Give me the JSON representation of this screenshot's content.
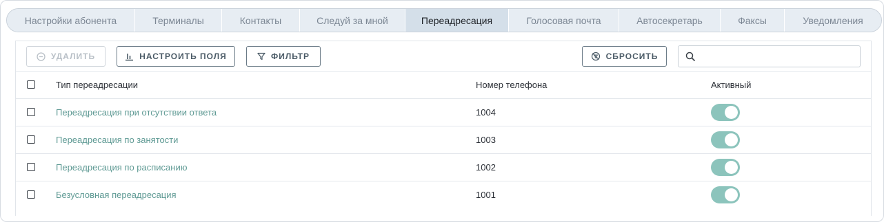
{
  "tabs": [
    {
      "label": "Настройки абонента",
      "active": false
    },
    {
      "label": "Терминалы",
      "active": false
    },
    {
      "label": "Контакты",
      "active": false
    },
    {
      "label": "Следуй за мной",
      "active": false
    },
    {
      "label": "Переадресация",
      "active": true
    },
    {
      "label": "Голосовая почта",
      "active": false
    },
    {
      "label": "Автосекретарь",
      "active": false
    },
    {
      "label": "Факсы",
      "active": false
    },
    {
      "label": "Уведомления",
      "active": false
    }
  ],
  "toolbar": {
    "delete_label": "Удалить",
    "configure_fields_label": "Настроить поля",
    "filter_label": "Фильтр",
    "reset_label": "Сбросить",
    "search_placeholder": ""
  },
  "table": {
    "columns": {
      "type": "Тип переадресации",
      "phone": "Номер телефона",
      "active": "Активный"
    },
    "rows": [
      {
        "type": "Переадресация при отсутствии ответа",
        "phone": "1004",
        "active": true
      },
      {
        "type": "Переадресация по занятости",
        "phone": "1003",
        "active": true
      },
      {
        "type": "Переадресация по расписанию",
        "phone": "1002",
        "active": true
      },
      {
        "type": "Безусловная переадресация",
        "phone": "1001",
        "active": true
      }
    ]
  },
  "colors": {
    "accent": "#5f9a94",
    "toggle_on": "#8cc4bc",
    "tab_active": "#d4dfe9",
    "tab_bg": "#e7edf3"
  }
}
